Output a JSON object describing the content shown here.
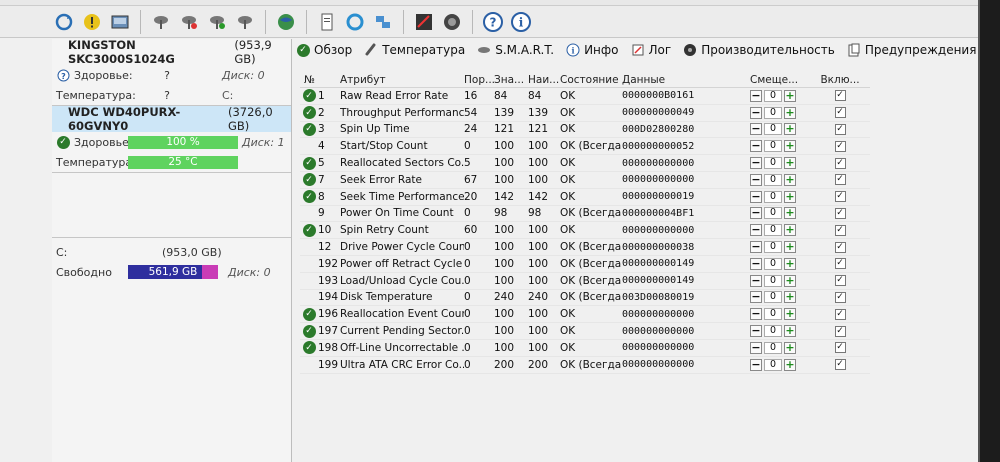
{
  "left": {
    "disks": [
      {
        "model": "KINGSTON SKC3000S1024G",
        "capacity": "(953,9 GB)",
        "health_label": "Здоровье:",
        "health_value": "?",
        "disk_label": "Диск: 0",
        "temp_label": "Температура:",
        "temp_value": "?",
        "extra": "C:"
      },
      {
        "model": "WDC WD40PURX-60GVNY0",
        "capacity": "(3726,0 GB)",
        "health_label": "Здоровье:",
        "health_value": "100 %",
        "disk_label": "Диск: 1",
        "temp_label": "Температура:",
        "temp_value": "25 °C"
      }
    ],
    "volume": {
      "letter": "C:",
      "capacity": "(953,0 GB)",
      "free_label": "Свободно",
      "free_value": "561,9 GB",
      "disk_label": "Диск: 0"
    }
  },
  "tabs": [
    {
      "label": "Обзор",
      "icon": "check-circle-icon"
    },
    {
      "label": "Температура",
      "icon": "thermometer-icon"
    },
    {
      "label": "S.M.A.R.T.",
      "icon": "smart-icon"
    },
    {
      "label": "Инфо",
      "icon": "info-icon"
    },
    {
      "label": "Лог",
      "icon": "log-icon"
    },
    {
      "label": "Производительность",
      "icon": "performance-icon"
    },
    {
      "label": "Предупреждения",
      "icon": "warnings-icon"
    }
  ],
  "grid": {
    "headers": [
      "№",
      "Атрибут",
      "Пор...",
      "Зна...",
      "Наи...",
      "Состояние",
      "Данные",
      "Смеще...",
      "Вклю..."
    ],
    "rows": [
      {
        "ok": true,
        "id": "1",
        "name": "Raw Read Error Rate",
        "thr": "16",
        "val": "84",
        "worst": "84",
        "state": "OK",
        "data": "0000000B0161",
        "offset": "0",
        "enabled": true
      },
      {
        "ok": true,
        "id": "2",
        "name": "Throughput Performance",
        "thr": "54",
        "val": "139",
        "worst": "139",
        "state": "OK",
        "data": "000000000049",
        "offset": "0",
        "enabled": true
      },
      {
        "ok": true,
        "id": "3",
        "name": "Spin Up Time",
        "thr": "24",
        "val": "121",
        "worst": "121",
        "state": "OK",
        "data": "000D02800280",
        "offset": "0",
        "enabled": true
      },
      {
        "ok": false,
        "id": "4",
        "name": "Start/Stop Count",
        "thr": "0",
        "val": "100",
        "worst": "100",
        "state": "OK (Всегда...",
        "data": "000000000052",
        "offset": "0",
        "enabled": true
      },
      {
        "ok": true,
        "id": "5",
        "name": "Reallocated Sectors Co...",
        "thr": "5",
        "val": "100",
        "worst": "100",
        "state": "OK",
        "data": "000000000000",
        "offset": "0",
        "enabled": true
      },
      {
        "ok": true,
        "id": "7",
        "name": "Seek Error Rate",
        "thr": "67",
        "val": "100",
        "worst": "100",
        "state": "OK",
        "data": "000000000000",
        "offset": "0",
        "enabled": true
      },
      {
        "ok": true,
        "id": "8",
        "name": "Seek Time Performance",
        "thr": "20",
        "val": "142",
        "worst": "142",
        "state": "OK",
        "data": "000000000019",
        "offset": "0",
        "enabled": true
      },
      {
        "ok": false,
        "id": "9",
        "name": "Power On Time Count",
        "thr": "0",
        "val": "98",
        "worst": "98",
        "state": "OK (Всегда...",
        "data": "000000004BF1",
        "offset": "0",
        "enabled": true
      },
      {
        "ok": true,
        "id": "10",
        "name": "Spin Retry Count",
        "thr": "60",
        "val": "100",
        "worst": "100",
        "state": "OK",
        "data": "000000000000",
        "offset": "0",
        "enabled": true
      },
      {
        "ok": false,
        "id": "12",
        "name": "Drive Power Cycle Count",
        "thr": "0",
        "val": "100",
        "worst": "100",
        "state": "OK (Всегда...",
        "data": "000000000038",
        "offset": "0",
        "enabled": true
      },
      {
        "ok": false,
        "id": "192",
        "name": "Power off Retract Cycle ...",
        "thr": "0",
        "val": "100",
        "worst": "100",
        "state": "OK (Всегда...",
        "data": "000000000149",
        "offset": "0",
        "enabled": true
      },
      {
        "ok": false,
        "id": "193",
        "name": "Load/Unload Cycle Cou...",
        "thr": "0",
        "val": "100",
        "worst": "100",
        "state": "OK (Всегда...",
        "data": "000000000149",
        "offset": "0",
        "enabled": true
      },
      {
        "ok": false,
        "id": "194",
        "name": "Disk Temperature",
        "thr": "0",
        "val": "240",
        "worst": "240",
        "state": "OK (Всегда...",
        "data": "003D00080019",
        "offset": "0",
        "enabled": true
      },
      {
        "ok": true,
        "id": "196",
        "name": "Reallocation Event Count",
        "thr": "0",
        "val": "100",
        "worst": "100",
        "state": "OK",
        "data": "000000000000",
        "offset": "0",
        "enabled": true
      },
      {
        "ok": true,
        "id": "197",
        "name": "Current Pending Sector...",
        "thr": "0",
        "val": "100",
        "worst": "100",
        "state": "OK",
        "data": "000000000000",
        "offset": "0",
        "enabled": true
      },
      {
        "ok": true,
        "id": "198",
        "name": "Off-Line Uncorrectable ...",
        "thr": "0",
        "val": "100",
        "worst": "100",
        "state": "OK",
        "data": "000000000000",
        "offset": "0",
        "enabled": true
      },
      {
        "ok": false,
        "id": "199",
        "name": "Ultra ATA CRC Error Co...",
        "thr": "0",
        "val": "200",
        "worst": "200",
        "state": "OK (Всегда...",
        "data": "000000000000",
        "offset": "0",
        "enabled": true
      }
    ]
  },
  "colors": {
    "health_bar": "#5fd35f",
    "free_bar": "#2e2e9e",
    "ok_icon": "#2b7a2b",
    "selected_disk": "#cde6f7"
  }
}
